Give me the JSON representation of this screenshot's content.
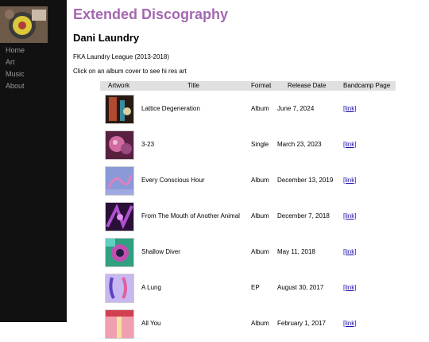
{
  "nav": [
    "Home",
    "Art",
    "Music",
    "About"
  ],
  "page_title": "Extended Discography",
  "artist_name": "Dani Laundry",
  "aka": "FKA Laundry League (2013-2018)",
  "instruction": "Click on an album cover to see hi res art",
  "table": {
    "columns": [
      "Artwork",
      "Title",
      "Format",
      "Release Date",
      "Bandcamp Page"
    ],
    "rows": [
      {
        "title": "Lattice Degeneration",
        "format": "Album",
        "date": "June 7, 2024",
        "link": "[link]"
      },
      {
        "title": "3-23",
        "format": "Single",
        "date": "March 23, 2023",
        "link": "[link]"
      },
      {
        "title": "Every Conscious Hour",
        "format": "Album",
        "date": "December 13, 2019",
        "link": "[link]"
      },
      {
        "title": "From The Mouth of Another Animal",
        "format": "Album",
        "date": "December 7, 2018",
        "link": "[link]"
      },
      {
        "title": "Shallow Diver",
        "format": "Album",
        "date": "May 11, 2018",
        "link": "[link]"
      },
      {
        "title": "A Lung",
        "format": "EP",
        "date": "August 30, 2017",
        "link": "[link]"
      },
      {
        "title": "All You",
        "format": "Album",
        "date": "February 1, 2017",
        "link": "[link]"
      }
    ]
  }
}
